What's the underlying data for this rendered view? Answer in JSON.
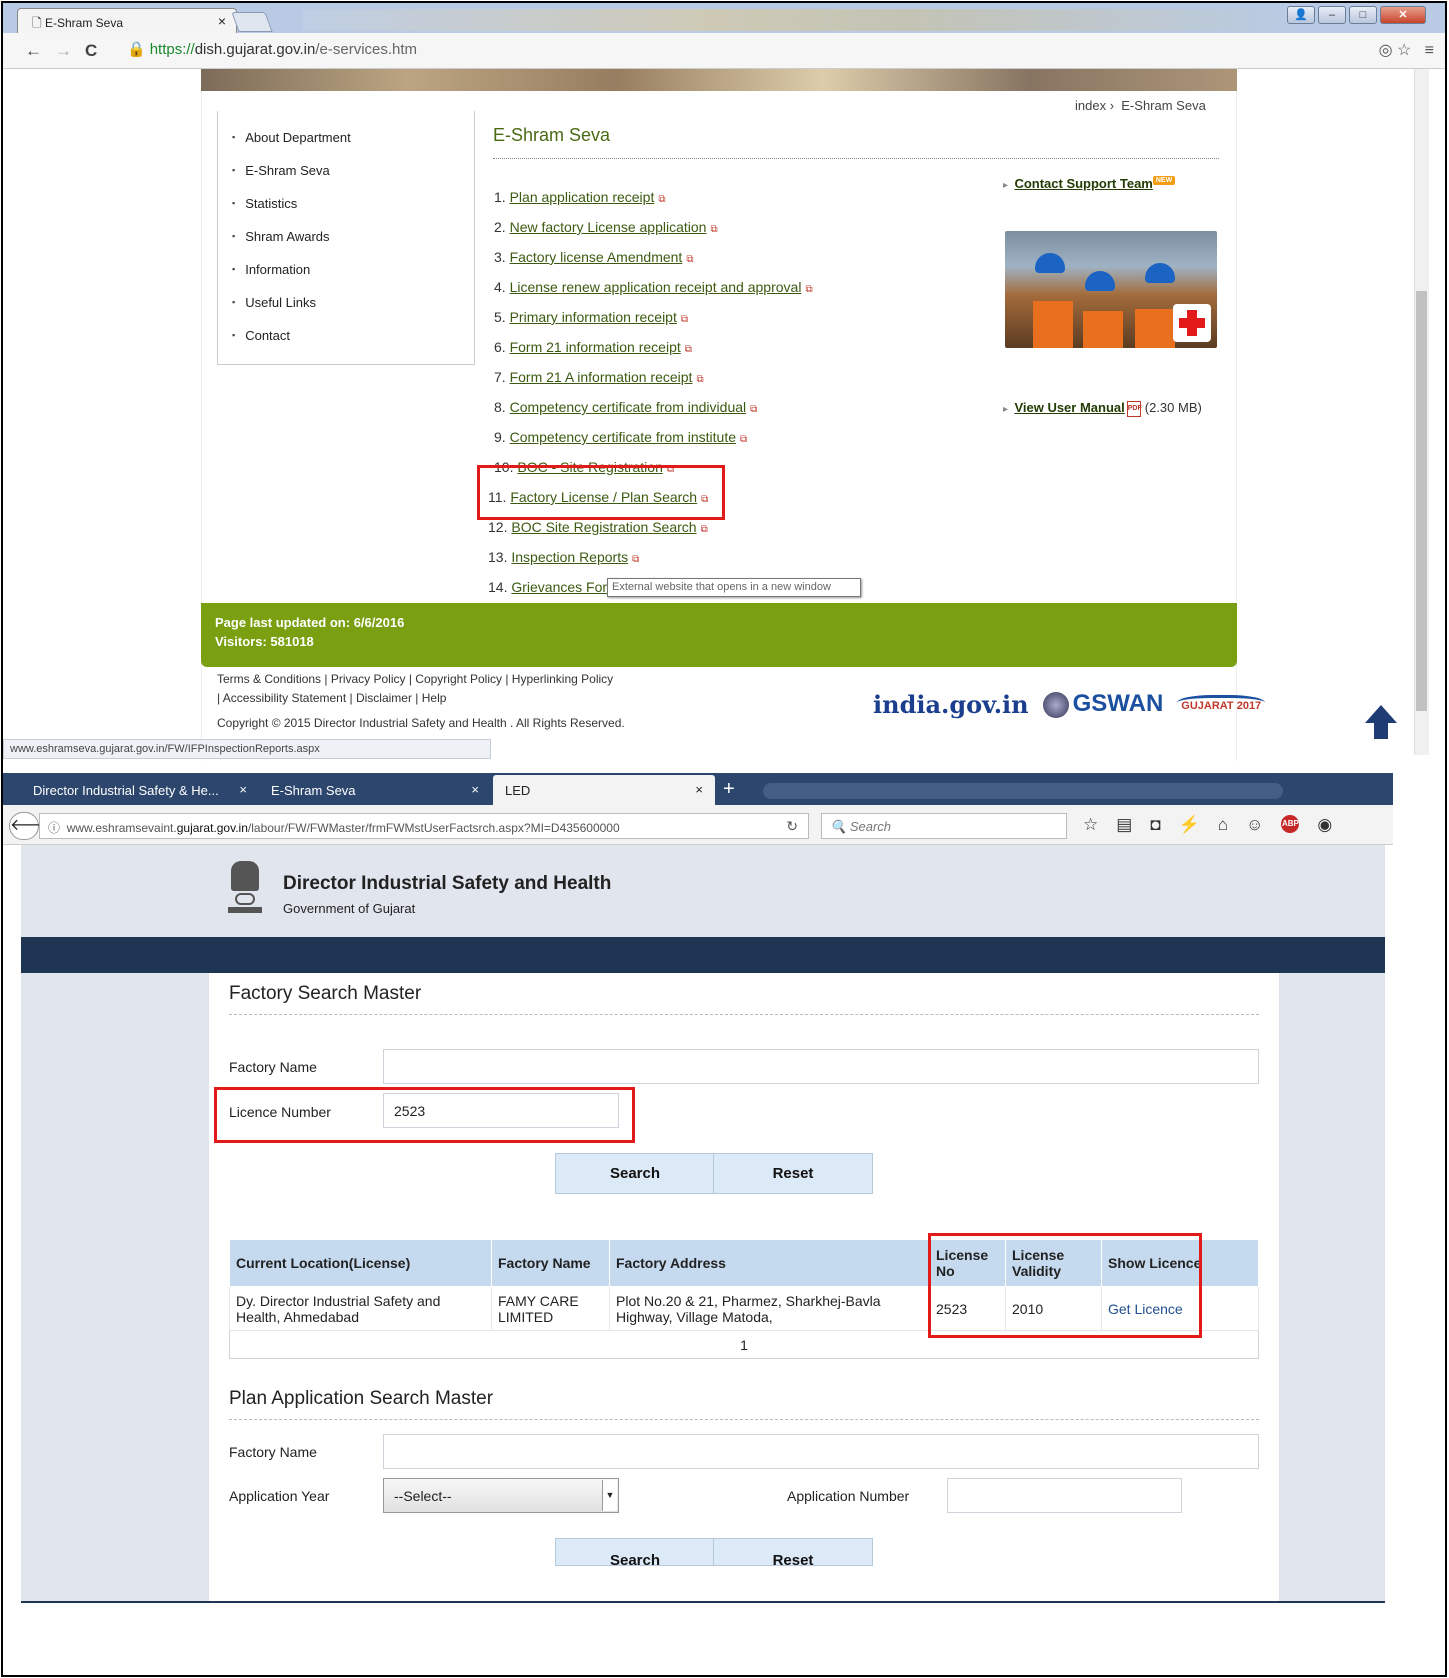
{
  "chrome": {
    "tab_title": "E-Shram Seva",
    "tab_close": "×",
    "url_https": "https://",
    "url_domain": "dish.gujarat.gov.in",
    "url_path": "/e-services.htm",
    "breadcrumb_index": "index",
    "breadcrumb_sep": "›",
    "breadcrumb_current": "E-Shram Seva",
    "sidebar": [
      "About Department",
      "E-Shram Seva",
      "Statistics",
      "Shram Awards",
      "Information",
      "Useful Links",
      "Contact"
    ],
    "section_title": "E-Shram Seva",
    "services": [
      {
        "num": "1.",
        "label": "Plan application receipt"
      },
      {
        "num": "2.",
        "label": "New factory License application"
      },
      {
        "num": "3.",
        "label": "Factory license Amendment"
      },
      {
        "num": "4.",
        "label": "License renew application receipt and approval"
      },
      {
        "num": "5.",
        "label": "Primary information receipt"
      },
      {
        "num": "6.",
        "label": "Form 21 information receipt"
      },
      {
        "num": "7.",
        "label": "Form 21 A information receipt"
      },
      {
        "num": "8.",
        "label": "Competency certificate from individual"
      },
      {
        "num": "9.",
        "label": "Competency certificate from institute"
      },
      {
        "num": "10.",
        "label": "BOC - Site Registration"
      },
      {
        "num": "11.",
        "label": "Factory License / Plan Search"
      },
      {
        "num": "12.",
        "label": "BOC Site Registration Search"
      },
      {
        "num": "13.",
        "label": "Inspection Reports"
      },
      {
        "num": "14.",
        "label": "Grievances Form"
      }
    ],
    "tooltip": "External website that opens in a new window",
    "contact_support": "Contact Support Team",
    "new_badge": "NEW",
    "view_manual": "View User Manual",
    "manual_size": "(2.30 MB)",
    "last_updated_label": "Page last updated on:",
    "last_updated_value": "6/6/2016",
    "visitors_label": "Visitors:",
    "visitors_value": "581018",
    "footer_line1": "Terms & Conditions  |  Privacy Policy  |  Copyright Policy  |  Hyperlinking Policy",
    "footer_line2": "|  Accessibility Statement  |  Disclaimer  |  Help",
    "copyright": "Copyright © 2015 Director Industrial Safety and Health . All Rights Reserved.",
    "logo_india": "india.gov.in",
    "logo_gswan": "GSWAN",
    "logo_gujarat": "GUJARAT 2017",
    "status_url": "www.eshramseva.gujarat.gov.in/FW/IFPInspectionReports.aspx"
  },
  "firefox": {
    "tabs": [
      "Director Industrial Safety & He...",
      "E-Shram Seva",
      "LED"
    ],
    "tab_close": "×",
    "plus": "+",
    "url_prefix": "www.eshramsevaint.",
    "url_domain": "gujarat.gov.in",
    "url_path": "/labour/FW/FWMaster/frmFWMstUserFactsrch.aspx?MI=D435600000",
    "search_placeholder": "Search",
    "header_title": "Director Industrial Safety and Health",
    "header_subtitle": "Government of Gujarat",
    "factory_search": {
      "title": "Factory Search Master",
      "factory_name_label": "Factory Name",
      "factory_name_value": "",
      "licence_label": "Licence Number",
      "licence_value": "2523",
      "search_button": "Search",
      "reset_button": "Reset"
    },
    "results": {
      "headers": [
        "Current Location(License)",
        "Factory Name",
        "Factory Address",
        "License No",
        "License Validity",
        "Show Licence"
      ],
      "rows": [
        {
          "location": "Dy. Director Industrial Safety and Health, Ahmedabad",
          "factory": "FAMY CARE LIMITED",
          "address": "Plot No.20 & 21, Pharmez, Sharkhej-Bavla Highway, Village Matoda,",
          "license_no": "2523",
          "validity": "2010",
          "link": "Get Licence"
        }
      ],
      "page": "1"
    },
    "plan_search": {
      "title": "Plan Application Search Master",
      "factory_name_label": "Factory Name",
      "year_label": "Application Year",
      "year_value": "--Select--",
      "number_label": "Application Number",
      "search_button": "Search",
      "reset_button": "Reset"
    }
  },
  "colors": {
    "highlight": "#e31a1a",
    "green_bar": "#7aa011",
    "navy_band": "#1e3554",
    "table_header": "#c5d9ef"
  }
}
